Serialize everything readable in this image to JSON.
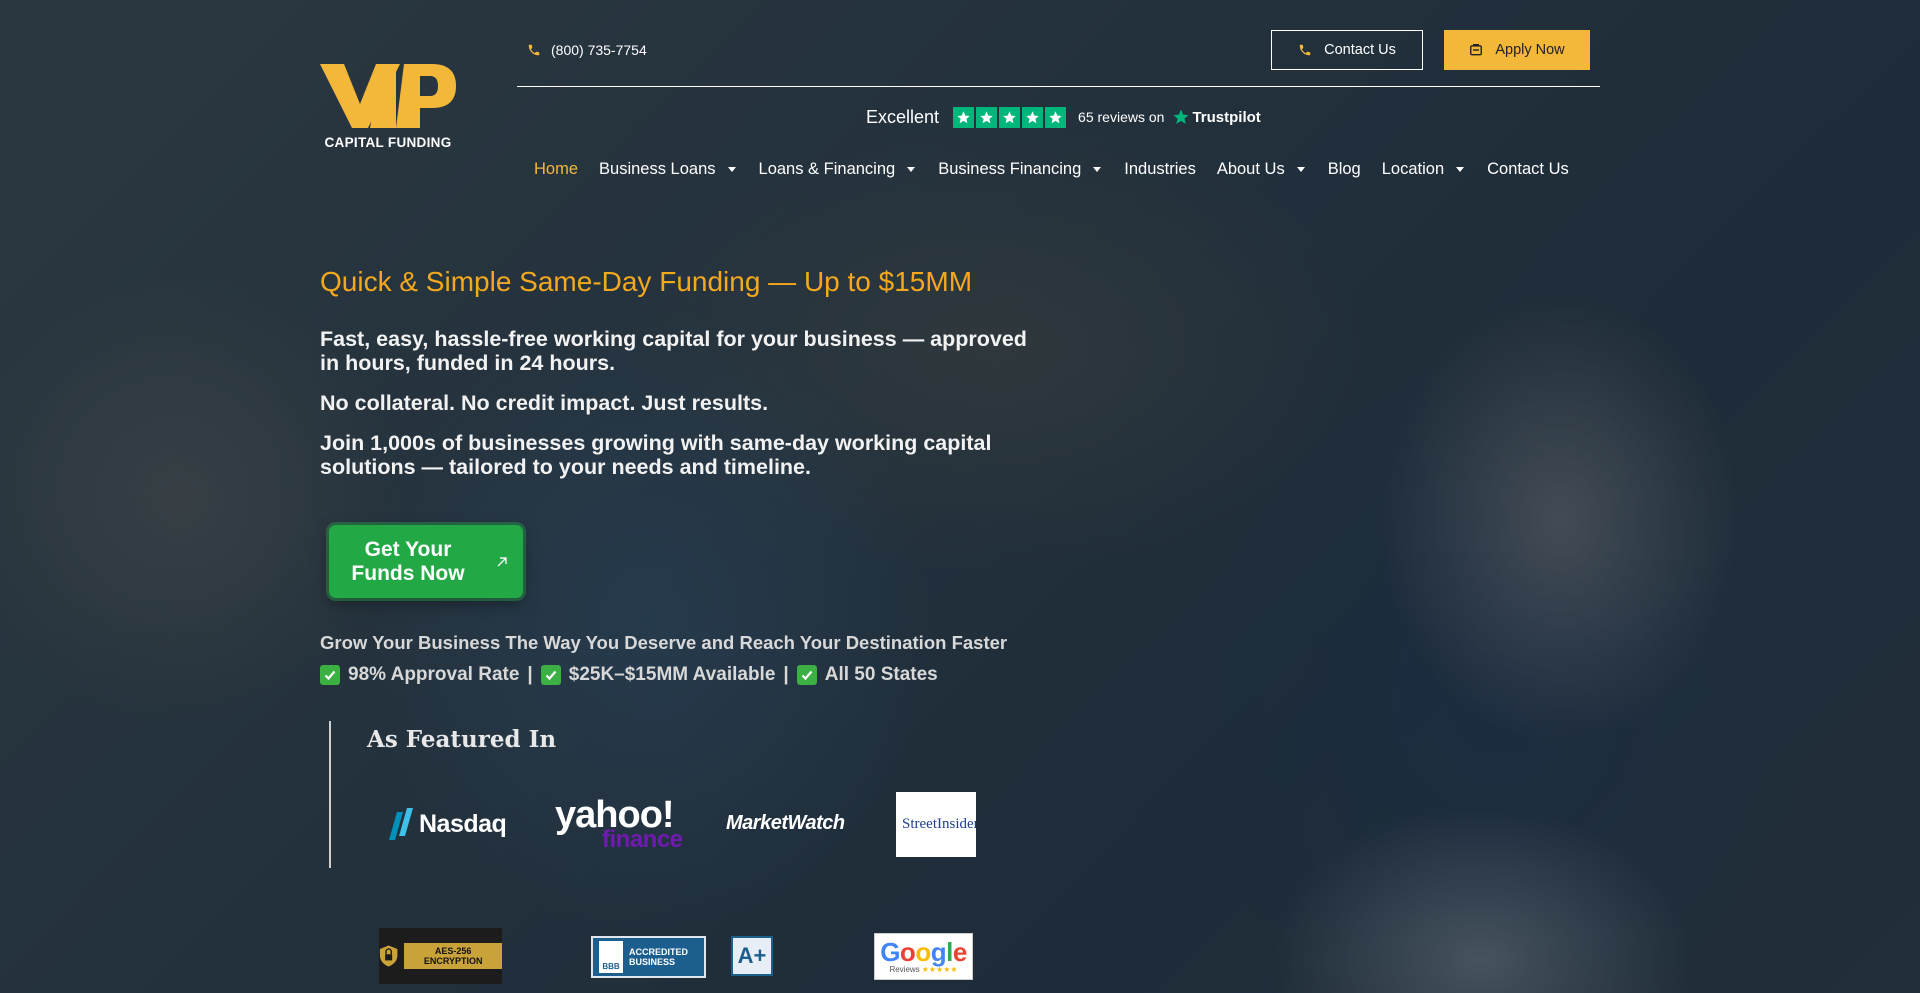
{
  "logo": {
    "text": "CAPITAL FUNDING",
    "mark": "VIP"
  },
  "header": {
    "phone": "(800) 735-7754",
    "contact_button": "Contact Us",
    "apply_button": "Apply Now"
  },
  "trustpilot": {
    "rating_label": "Excellent",
    "stars": 5,
    "reviews": "65 reviews on",
    "brand": "Trustpilot"
  },
  "nav": {
    "items": [
      {
        "label": "Home",
        "active": true,
        "dropdown": false
      },
      {
        "label": "Business Loans",
        "active": false,
        "dropdown": true
      },
      {
        "label": "Loans & Financing",
        "active": false,
        "dropdown": true
      },
      {
        "label": "Business Financing",
        "active": false,
        "dropdown": true
      },
      {
        "label": "Industries",
        "active": false,
        "dropdown": false
      },
      {
        "label": "About Us",
        "active": false,
        "dropdown": true
      },
      {
        "label": "Blog",
        "active": false,
        "dropdown": false
      },
      {
        "label": "Location",
        "active": false,
        "dropdown": true
      },
      {
        "label": "Contact Us",
        "active": false,
        "dropdown": false
      }
    ]
  },
  "hero": {
    "title": "Quick & Simple Same-Day Funding — Up to $15MM",
    "p1": "Fast, easy, hassle-free working capital for your business — approved in hours, funded in 24 hours.",
    "p2": "No collateral. No credit impact. Just results.",
    "p3": "Join 1,000s of businesses growing with same-day working capital solutions — tailored to your needs and timeline.",
    "cta": "Get Your Funds Now",
    "grow": "Grow Your Business The Way You Deserve and Reach Your Destination Faster",
    "stats": [
      "98% Approval Rate",
      "$25K–$15MM Available",
      "All 50 States"
    ],
    "stat_separator": "|"
  },
  "featured": {
    "title": "As Featured In",
    "logos": {
      "nasdaq": "Nasdaq",
      "yahoo_top": "yahoo!",
      "yahoo_bottom": "finance",
      "marketwatch": "MarketWatch",
      "streetinsider": "StreetInsider"
    }
  },
  "badges": {
    "aes": "AES-256 ENCRYPTION",
    "bbb_line1": "ACCREDITED",
    "bbb_line2": "BUSINESS",
    "bbb_seal": "BBB",
    "aplus": "A+",
    "google": "Google",
    "google_sub": "Reviews"
  },
  "colors": {
    "accent": "#f3b73a",
    "headline": "#f3a81d",
    "cta": "#23a846",
    "trustpilot_green": "#00b67a"
  }
}
